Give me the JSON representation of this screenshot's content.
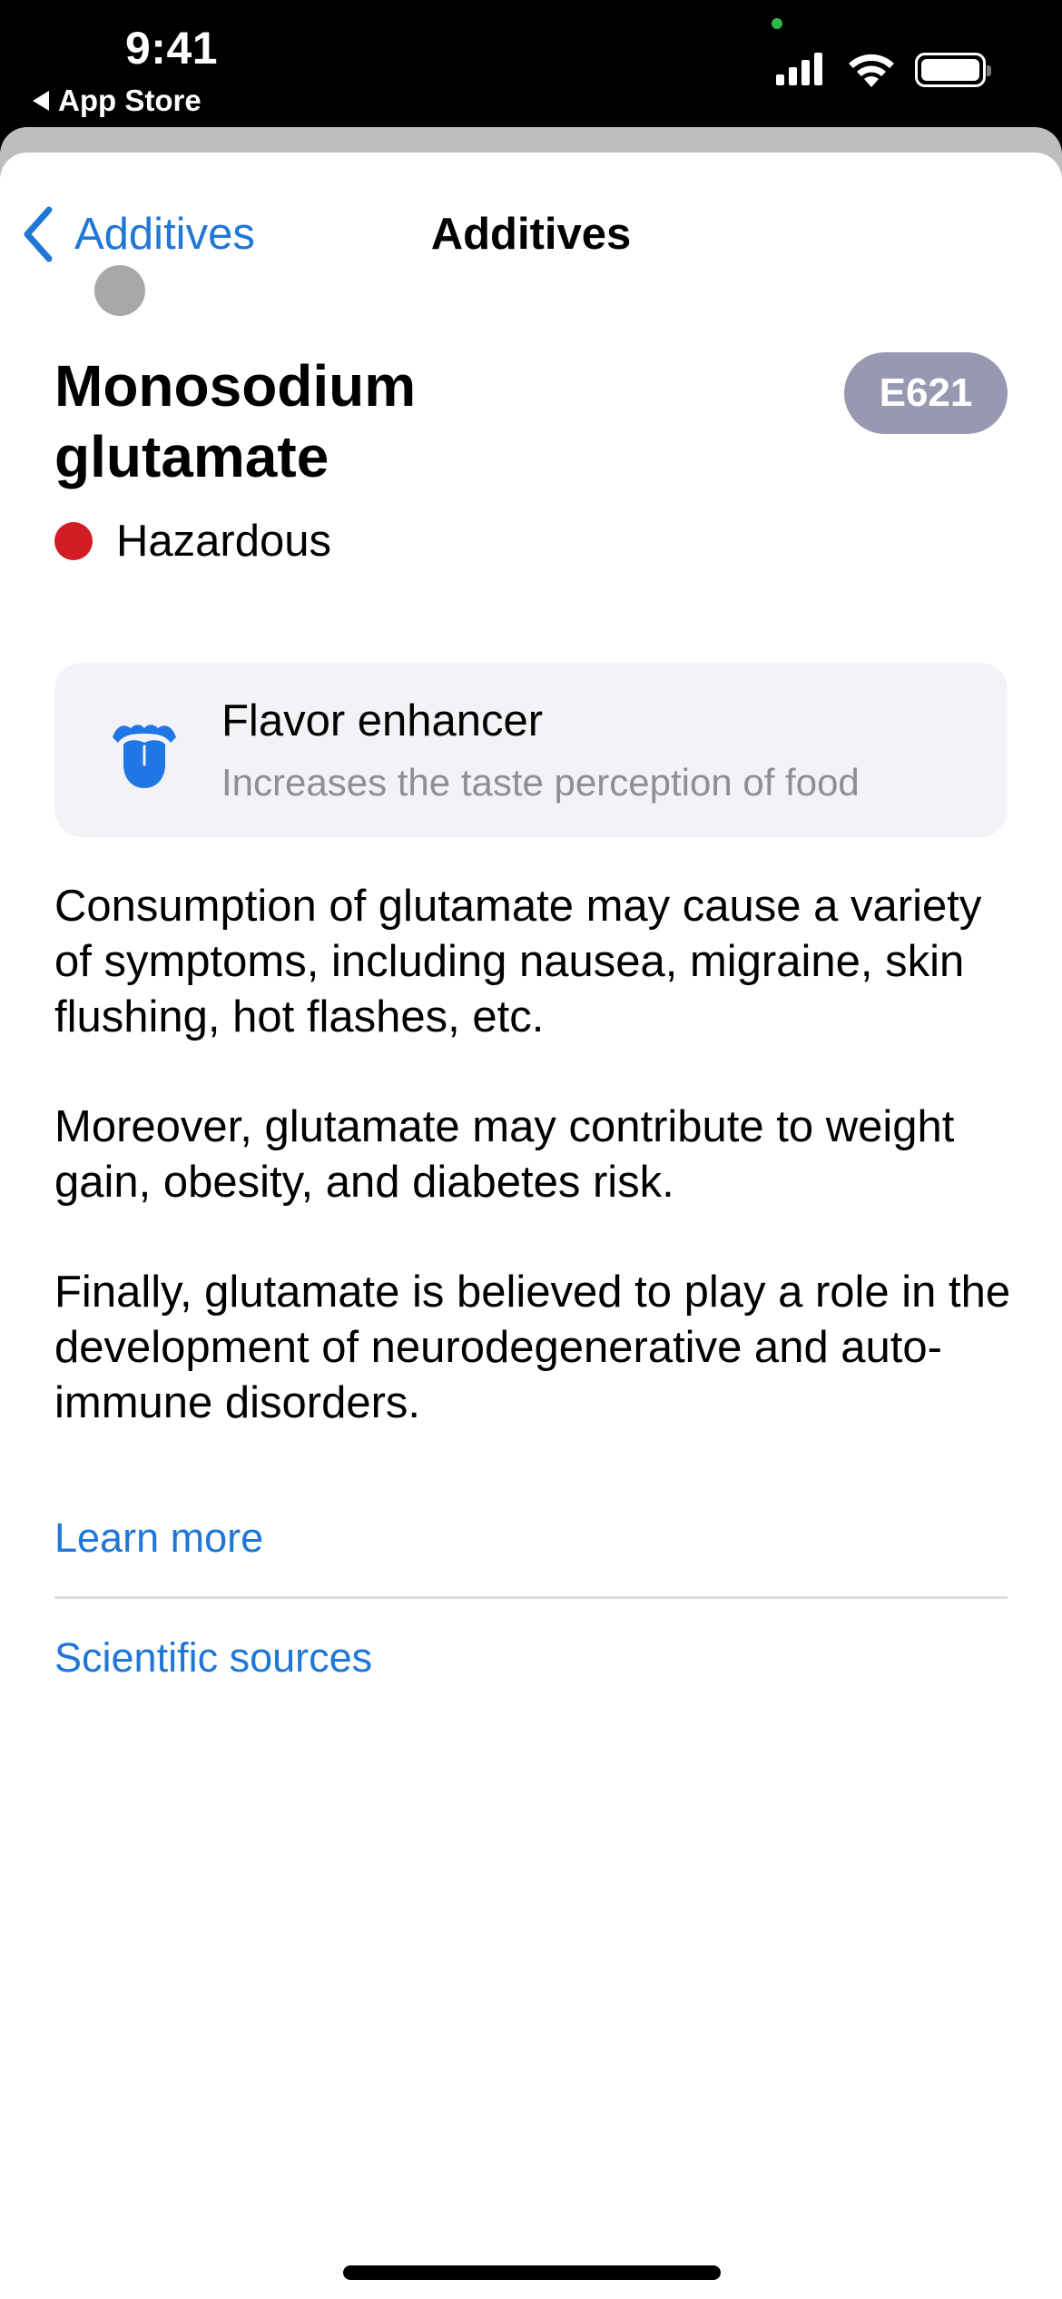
{
  "status_bar": {
    "time": "9:41",
    "back_app_label": "App Store",
    "icons": [
      "signal-icon",
      "wifi-icon",
      "battery-icon"
    ]
  },
  "nav": {
    "back_label": "Additives",
    "title": "Additives"
  },
  "additive": {
    "name": "Monosodium glutamate",
    "code": "E621",
    "status": "Hazardous",
    "status_color": "#d21d25",
    "badge_color": "#9898b2"
  },
  "function_card": {
    "icon": "tongue-icon",
    "title": "Flavor enhancer",
    "subtitle": "Increases the taste perception of food"
  },
  "description": [
    "Consumption of glutamate may cause a variety of symptoms, including nausea, migraine, skin flushing, hot flashes, etc.",
    "Moreover, glutamate may contribute to weight gain, obesity, and diabetes risk.",
    "Finally, glutamate is believed to play a role in the development of neurodegenerative and auto-immune disorders."
  ],
  "links": {
    "learn_more": "Learn more",
    "scientific_sources": "Scientific sources"
  },
  "colors": {
    "accent": "#1f77d6"
  }
}
